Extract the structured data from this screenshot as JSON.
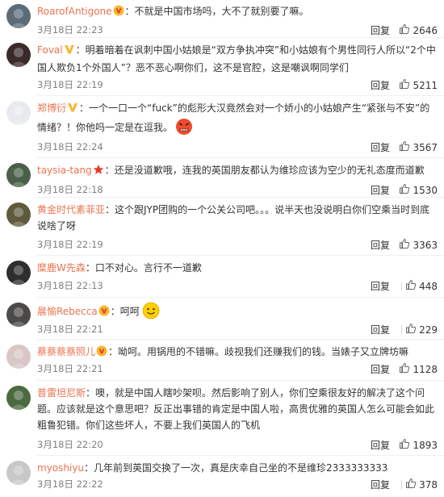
{
  "reply_label": "回复",
  "colors": {
    "username": "#eb7350",
    "date": "#808080",
    "text": "#333333",
    "badge_vip": "#f7b733",
    "badge_star": "#e8391d",
    "emoji_face": "#ffd000"
  },
  "comments": [
    {
      "username": "RoarofAntigone",
      "badge": "vip-badge-icon",
      "text": "：不就是中国市场吗，大不了就别要了嘛。",
      "date": "3月18日 22:23",
      "likes": "2646"
    },
    {
      "username": "Foval",
      "badge": "v-badge-icon",
      "text": "：明着暗着在讽刺中国小姑娘是“双方争执冲突”和小姑娘有个男性同行人所以“2个中国人欺负1个外国人”？恶不恶心啊你们，这不是官腔，这是嘲讽啊同学们",
      "date": "3月18日 22:19",
      "likes": "5211"
    },
    {
      "username": "郑博衍",
      "badge": "v-badge-icon",
      "text": "：一个一口一个“fuck”的彪形大汉竟然会对一个娇小的小姑娘产生“紧张与不安”的情绪？！你他吗一定是在逗我。",
      "emoji": "angry-face-icon",
      "date": "3月18日 22:24",
      "likes": "3567"
    },
    {
      "username": "taysia-tang",
      "badge": "star-badge-icon",
      "text": "：还是没道歉哦，连我的英国朋友都认为维珍应该为空少的无礼态度而道歉",
      "date": "3月18日 22:18",
      "likes": "1530"
    },
    {
      "username": "黄金时代素菲亚",
      "badge": "",
      "text": "：这个跟JYP团购的一个公关公司吧。。。说半天也没说明白你们空乘当时到底说啥了呀",
      "date": "3月18日 22:19",
      "likes": "3363"
    },
    {
      "username": "糜鹿W先森",
      "badge": "",
      "text": "：口不对心。言行不一道歉",
      "date": "3月18日 22:13",
      "likes": "448"
    },
    {
      "username": "晨愉Rebecca",
      "badge": "vip-badge-icon",
      "text": "：呵呵",
      "emoji": "smile-face-icon",
      "date": "3月18日 22:21",
      "likes": "229"
    },
    {
      "username": "蔡蔡蔡蔡照儿",
      "badge": "vip-badge-icon",
      "text": "：呦呵。用锅甩的不错嘛。歧视我们还赚我们的钱。当婊子又立牌坊嘛",
      "date": "3月18日 22:21",
      "likes": "1128"
    },
    {
      "username": "普雷坦尼斯",
      "badge": "",
      "text": "：噢，就是中国人瞎吵架呗。然后影响了别人，你们空乘很友好的解决了这个问题。应该就是这个意思吧？反正出事错的肯定是中国人啦，高贵优雅的英国人怎么可能会如此粗鲁犯错。你们这些坏人，不要上我们英国人的飞机",
      "date": "3月18日 22:20",
      "likes": "1893"
    },
    {
      "username": "myoshiyu",
      "badge": "",
      "text": "：几年前到英国交换了一次，真是庆幸自己坐的不是维珍2333333333",
      "date": "3月18日 22:22",
      "likes": "378"
    }
  ]
}
